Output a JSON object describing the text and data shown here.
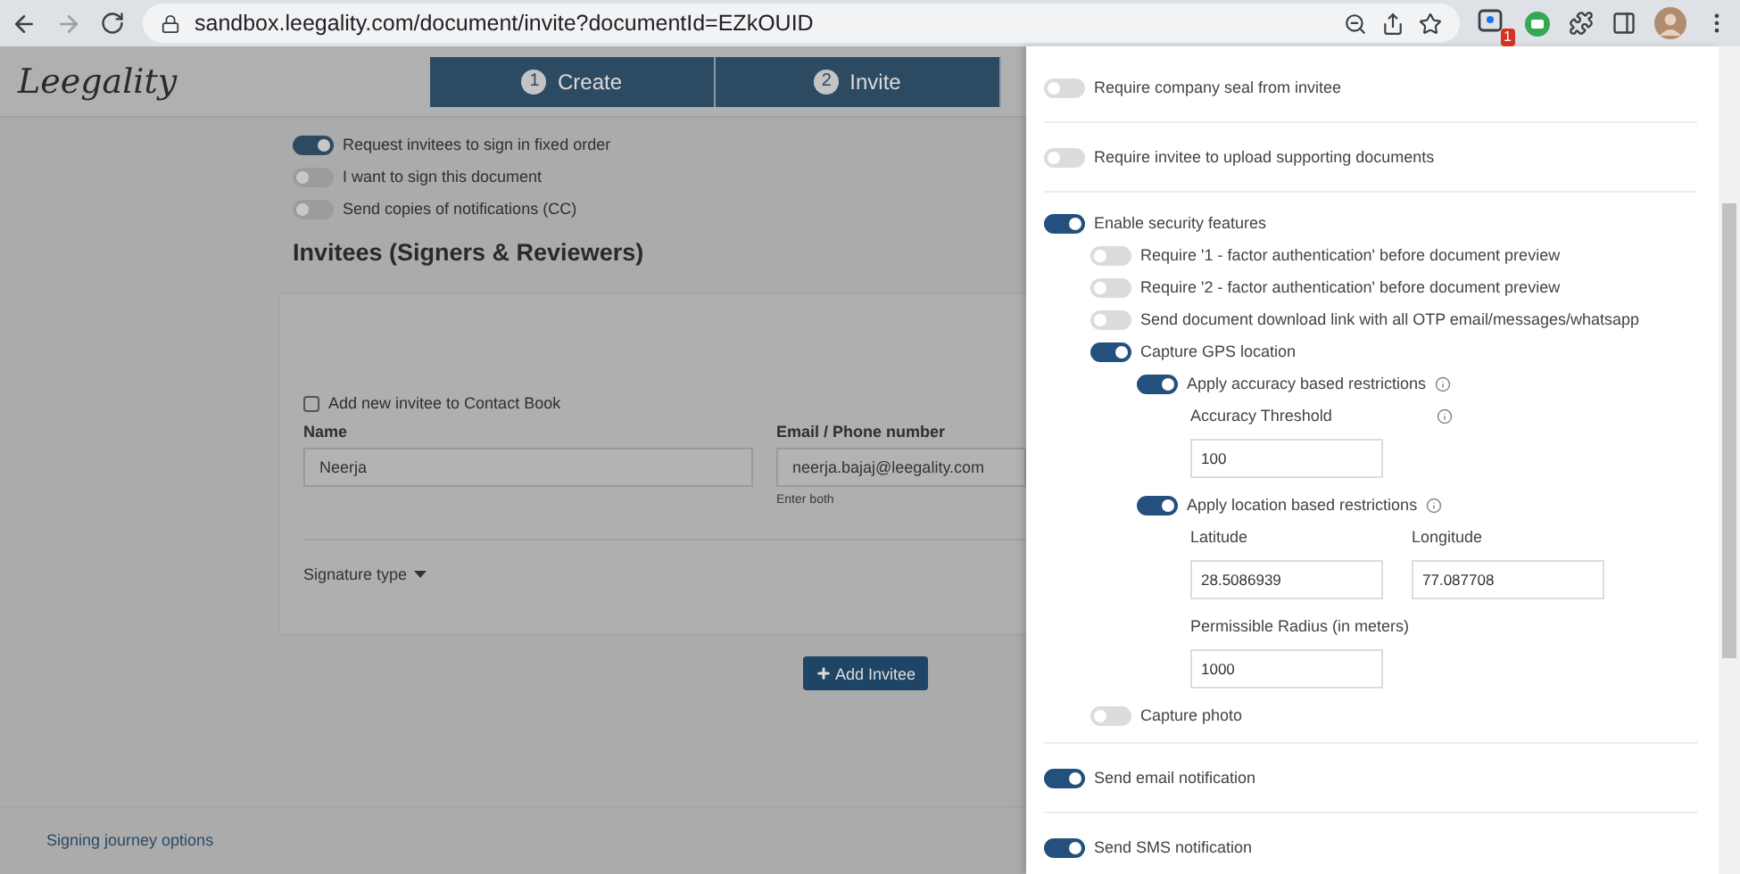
{
  "browser": {
    "url": "sandbox.leegality.com/document/invite?documentId=EZkOUID",
    "extension_badge": "1"
  },
  "header": {
    "logo": "Leegality",
    "steps": [
      {
        "number": "1",
        "label": "Create"
      },
      {
        "number": "2",
        "label": "Invite"
      }
    ]
  },
  "options": [
    {
      "label": "Request invitees to sign in fixed order",
      "on": true
    },
    {
      "label": "I want to sign this document",
      "on": false
    },
    {
      "label": "Send copies of notifications (CC)",
      "on": false
    }
  ],
  "heading": "Invitees (Signers & Reviewers)",
  "invitee": {
    "contact_book": {
      "label": "Add new invitee to Contact Book",
      "checked": false
    },
    "name_label": "Name",
    "name_value": "Neerja",
    "email_label": "Email / Phone number",
    "email_value": "neerja.bajaj@leegality.com",
    "email_hint": "Enter both",
    "signature_type": "Signature type"
  },
  "add_button": "Add Invitee",
  "footer_link": "Signing journey options",
  "panel": {
    "settings": [
      {
        "kind": "toggle",
        "label": "Require company seal from invitee",
        "on": false
      },
      {
        "kind": "toggle",
        "label": "Require invitee to upload supporting documents",
        "on": false
      },
      {
        "kind": "toggle",
        "label": "Enable security features",
        "on": true,
        "children": [
          {
            "kind": "toggle",
            "label": "Require '1 - factor authentication' before document preview",
            "on": false
          },
          {
            "kind": "toggle",
            "label": "Require '2 - factor authentication' before document preview",
            "on": false
          },
          {
            "kind": "toggle",
            "label": "Send document download link with all OTP email/messages/whatsapp",
            "on": false
          },
          {
            "kind": "toggle",
            "label": "Capture GPS location",
            "on": true,
            "children": [
              {
                "kind": "toggle",
                "label": "Apply accuracy based restrictions",
                "on": true,
                "info": true,
                "children": [
                  {
                    "kind": "fields",
                    "fields": [
                      {
                        "label": "Accuracy Threshold",
                        "value": "100",
                        "info": true
                      }
                    ]
                  }
                ]
              },
              {
                "kind": "toggle",
                "label": "Apply location based restrictions",
                "on": true,
                "info": true,
                "children": [
                  {
                    "kind": "fields",
                    "fields": [
                      {
                        "label": "Latitude",
                        "value": "28.5086939"
                      },
                      {
                        "label": "Longitude",
                        "value": "77.087708"
                      }
                    ]
                  },
                  {
                    "kind": "fields",
                    "fields": [
                      {
                        "label": "Permissible Radius (in meters)",
                        "value": "1000"
                      }
                    ]
                  }
                ]
              }
            ]
          },
          {
            "kind": "toggle",
            "label": "Capture photo",
            "on": false
          }
        ]
      },
      {
        "kind": "toggle",
        "label": "Send email notification",
        "on": true
      },
      {
        "kind": "toggle",
        "label": "Send SMS notification",
        "on": true
      }
    ]
  }
}
